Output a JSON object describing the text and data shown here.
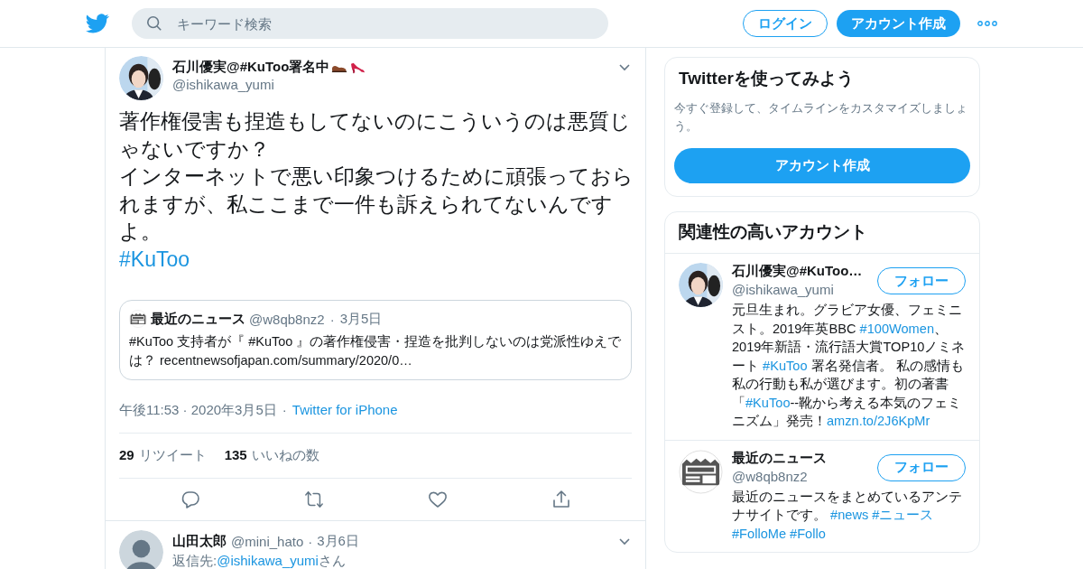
{
  "header": {
    "search_placeholder": "キーワード検索",
    "login_button": "ログイン",
    "signup_button": "アカウント作成"
  },
  "tweet": {
    "name": "石川優実@#KuToo署名中",
    "name_icons": [
      {
        "kind": "shoe"
      },
      {
        "kind": "heel"
      }
    ],
    "handle": "@ishikawa_yumi",
    "body": [
      {
        "kind": "text",
        "text": "著作権侵害も捏造もしてないのにこういうのは悪質じゃないですか？"
      },
      {
        "kind": "text",
        "text": "インターネットで悪い印象つけるために頑張っておられますが、私ここまで一件も訴えられてないんですよ。"
      },
      {
        "kind": "link",
        "text": "#KuToo"
      }
    ],
    "quote": {
      "name": "最近のニュース",
      "handle": "@w8qb8nz2",
      "separator": "·",
      "date": "3月5日",
      "text": "#KuToo 支持者が『 #KuToo 』の著作権侵害・捏造を批判しないのは党派性ゆえでは？ recentnewsofjapan.com/summary/2020/0…"
    },
    "timestamp": "午後11:53 · 2020年3月5日",
    "separator": "·",
    "source": "Twitter for iPhone",
    "retweet_count": "29",
    "retweet_label": "リツイート",
    "like_count": "135",
    "like_label": "いいねの数"
  },
  "reply": {
    "name": "山田太郎",
    "handle": "@mini_hato",
    "separator": "·",
    "date": "3月6日",
    "reply_label": "返信先:",
    "reply_handle": "@ishikawa_yumi",
    "reply_suffix": "さん"
  },
  "signup_card": {
    "title": "Twitterを使ってみよう",
    "text": "今すぐ登録して、タイムラインをカスタマイズしましょう。",
    "button": "アカウント作成"
  },
  "accounts": {
    "title": "関連性の高いアカウント",
    "items": [
      {
        "name": "石川優実@#KuToo…",
        "handle": "@ishikawa_yumi",
        "follow_button": "フォロー",
        "bio": [
          {
            "kind": "text",
            "text": "元旦生まれ。グラビア女優、フェミニスト。2019年英BBC "
          },
          {
            "kind": "link",
            "text": "#100Women"
          },
          {
            "kind": "text",
            "text": "、2019年新語・流行語大賞TOP10ノミネート "
          },
          {
            "kind": "link",
            "text": "#KuToo"
          },
          {
            "kind": "text",
            "text": " 署名発信者。 私の感情も私の行動も私が選びます。初の著書「"
          },
          {
            "kind": "link",
            "text": "#KuToo"
          },
          {
            "kind": "text",
            "text": "--靴から考える本気のフェミニズム」発売！"
          },
          {
            "kind": "link",
            "text": "amzn.to/2J6KpMr"
          }
        ]
      },
      {
        "avatar": {
          "kind": "news"
        },
        "name": "最近のニュース",
        "handle": "@w8qb8nz2",
        "follow_button": "フォロー",
        "bio": [
          {
            "kind": "text",
            "text": "最近のニュースをまとめているアンテナサイトです。 "
          },
          {
            "kind": "link",
            "text": "#news"
          },
          {
            "kind": "link",
            "text": "#ニュース"
          },
          {
            "kind": "link",
            "text": "#FolloMe"
          },
          {
            "kind": "link",
            "text": "#Follo"
          }
        ]
      }
    ]
  }
}
